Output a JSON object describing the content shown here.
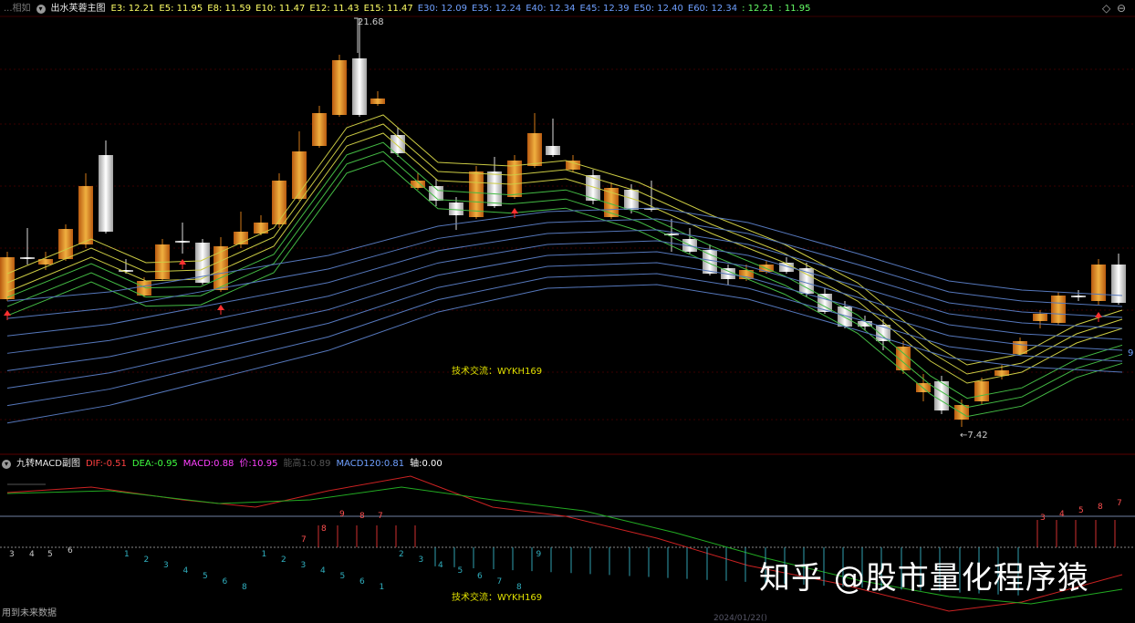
{
  "main": {
    "prefix": "...相如",
    "title": "出水芙蓉主图",
    "ema": [
      {
        "label": "E3:",
        "value": "12.21",
        "color": "#ffff66"
      },
      {
        "label": "E5:",
        "value": "11.95",
        "color": "#ffff66"
      },
      {
        "label": "E8:",
        "value": "11.59",
        "color": "#ffff66"
      },
      {
        "label": "E10:",
        "value": "11.47",
        "color": "#ffff66"
      },
      {
        "label": "E12:",
        "value": "11.43",
        "color": "#ffff66"
      },
      {
        "label": "E15:",
        "value": "11.47",
        "color": "#ffff66"
      },
      {
        "label": "E30:",
        "value": "12.09",
        "color": "#6fa0ff"
      },
      {
        "label": "E35:",
        "value": "12.24",
        "color": "#6fa0ff"
      },
      {
        "label": "E40:",
        "value": "12.34",
        "color": "#6fa0ff"
      },
      {
        "label": "E45:",
        "value": "12.39",
        "color": "#6fa0ff"
      },
      {
        "label": "E50:",
        "value": "12.40",
        "color": "#6fa0ff"
      },
      {
        "label": "E60:",
        "value": "12.34",
        "color": "#6fa0ff"
      },
      {
        "label": ":",
        "value": "12.21",
        "color": "#66ff66"
      },
      {
        "label": ":",
        "value": "11.95",
        "color": "#66ff66"
      }
    ],
    "high_label": "21.68",
    "low_label": "←7.42",
    "contact": "技术交流：WYKH169",
    "right_marker": "9"
  },
  "sub": {
    "title": "九转MACD副图",
    "dif": {
      "label": "DIF:",
      "value": "-0.51",
      "color": "#ff4040"
    },
    "dea": {
      "label": "DEA:",
      "value": "-0.95",
      "color": "#40ff40"
    },
    "macd": {
      "label": "MACD:",
      "value": "0.88",
      "color": "#ff40ff"
    },
    "price": {
      "label": "价:",
      "value": "10.95",
      "color": "#ff40ff"
    },
    "lead": {
      "label": "能高1:",
      "value": "0.89",
      "color": "#555555"
    },
    "macd120": {
      "label": "MACD120:",
      "value": "0.81",
      "color": "#6fa0ff"
    },
    "axis": {
      "label": "轴:",
      "value": "0.00",
      "color": "#ffffff"
    },
    "contact": "技术交流：WYKH169",
    "footer": "用到未来数据",
    "date_label": "2024/01/22()"
  },
  "upper_counts": [
    "3",
    "4",
    "5",
    "6",
    "7",
    "8",
    "9",
    "8",
    "7"
  ],
  "lower_counts": [
    "1",
    "2",
    "3",
    "4",
    "5",
    "6",
    "8",
    "1",
    "2",
    "3",
    "4",
    "5",
    "6",
    "1",
    "2",
    "3",
    "4",
    "5",
    "6",
    "7",
    "8",
    "9"
  ],
  "watermark": "知乎 @股市量化程序猿",
  "colors": {
    "up": "#d07818",
    "down": "#e8e8e8",
    "ema_short": "#cccc44",
    "ema_mid": "#44bb44",
    "ema_long": "#5577bb",
    "dif": "#cc2222",
    "dea": "#22aa22"
  }
}
